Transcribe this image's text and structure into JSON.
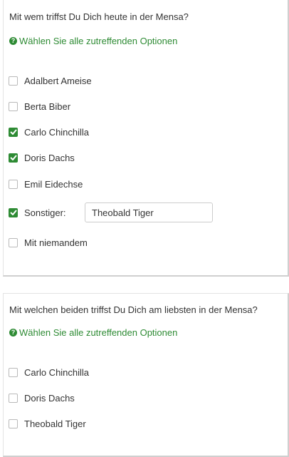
{
  "question1": {
    "title": "Mit wem triffst Du Dich heute in der Mensa?",
    "hint": "Wählen Sie alle zutreffenden Optionen",
    "hint_icon": "question-circle-icon",
    "options": [
      {
        "label": "Adalbert Ameise",
        "checked": false
      },
      {
        "label": "Berta Biber",
        "checked": false
      },
      {
        "label": "Carlo Chinchilla",
        "checked": true
      },
      {
        "label": "Doris Dachs",
        "checked": true
      },
      {
        "label": "Emil Eidechse",
        "checked": false
      },
      {
        "label": "Sonstiger:",
        "checked": true
      },
      {
        "label": "Mit niemandem",
        "checked": false
      }
    ],
    "other_value": "Theobald Tiger"
  },
  "question2": {
    "title": "Mit welchen beiden triffst Du Dich am liebsten in der Mensa?",
    "hint": "Wählen Sie alle zutreffenden Optionen",
    "hint_icon": "question-circle-icon",
    "options": [
      {
        "label": "Carlo Chinchilla",
        "checked": false
      },
      {
        "label": "Doris Dachs",
        "checked": false
      },
      {
        "label": "Theobald Tiger",
        "checked": false
      }
    ]
  },
  "colors": {
    "accent": "#2e8b34",
    "text": "#333333",
    "checkbox_border": "#b9b9b9"
  }
}
